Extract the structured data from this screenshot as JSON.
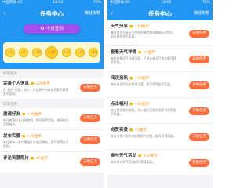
{
  "left": {
    "status": {
      "carrier": "中国移动 4G",
      "time": "18:03",
      "battery": "76%"
    },
    "header": {
      "back": "‹",
      "title": "任务中心",
      "rule": "赚钱攻略"
    },
    "sign_button": "今日签到",
    "coins": [
      "+5",
      "+5",
      "+10",
      "+10",
      "+15",
      "+20",
      "+30"
    ],
    "sections": [
      {
        "title": "新手任务",
        "tasks": [
          {
            "name": "完善个人信息",
            "reward": "+20金币",
            "desc": "在\"我的\"页面，进入个人信息中完善信息即可获得金币奖励。",
            "button": "去做任务"
          }
        ]
      },
      {
        "title": "日常任务",
        "tasks": [
          {
            "name": "邀请好友",
            "reward": "+20金币",
            "desc": "每日邀请好友注册使用，即可获得奖励，邀请越多奖励越多。",
            "button": "去做任务"
          },
          {
            "name": "发布实景",
            "reward": "+20金币",
            "desc": "每日发布一条实景图片并通过审核，即可获得金币奖励。",
            "button": "去做任务"
          },
          {
            "name": "评论实景照片",
            "reward": "+5金币",
            "desc": "",
            "button": "去做任务"
          }
        ]
      }
    ]
  },
  "right": {
    "status": {
      "carrier": "中国移动 4G",
      "time": "18:03",
      "battery": "76%"
    },
    "header": {
      "back": "‹",
      "title": "任务中心",
      "rule": "赚钱攻略"
    },
    "tasks": [
      {
        "name": "天气分享",
        "reward": "+10金币",
        "desc": "每日首次分享天气信息到微信朋友圈或QQ空间，即可获得金币奖励。",
        "button": "去做任务"
      },
      {
        "name": "查看天气详情",
        "reward": "+5金币",
        "desc": "每日查看天气详情页面，了解未来天气变化即可获得奖励。",
        "button": "去做任务"
      },
      {
        "name": "阅读资讯",
        "reward": "+10金币",
        "desc": "每日阅读资讯文章满三篇，即可获得金币奖励。",
        "button": "去做任务"
      },
      {
        "name": "点击福利",
        "reward": "+10金币",
        "desc": "点击首页福利图标，进入福利页面浏览即可获得金币奖励。",
        "button": "去做任务"
      },
      {
        "name": "点赞实景",
        "reward": "+5金币",
        "desc": "每日为他人发布的实景照片点赞，即可获得奖励。",
        "button": "去做任务"
      },
      {
        "name": "参与天气活动",
        "reward": "+10金币",
        "desc": "每日参与天气活动即可获得奖励。",
        "button": "去做任务"
      }
    ]
  },
  "colors": {
    "primary": "#2196f3",
    "sign": "#a64df0",
    "action": "#ff6d3a",
    "reward": "#ff8a00"
  }
}
